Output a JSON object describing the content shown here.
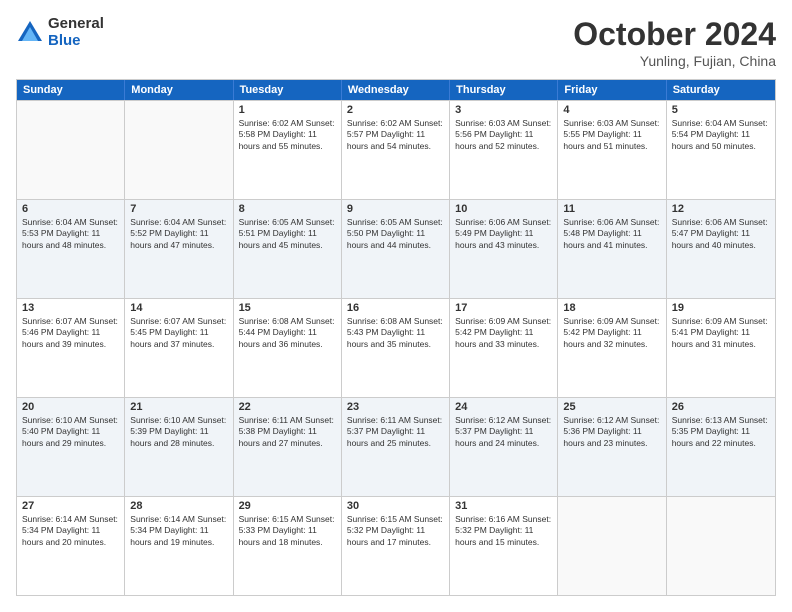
{
  "logo": {
    "general": "General",
    "blue": "Blue"
  },
  "title": "October 2024",
  "subtitle": "Yunling, Fujian, China",
  "header_days": [
    "Sunday",
    "Monday",
    "Tuesday",
    "Wednesday",
    "Thursday",
    "Friday",
    "Saturday"
  ],
  "rows": [
    [
      {
        "day": "",
        "info": ""
      },
      {
        "day": "",
        "info": ""
      },
      {
        "day": "1",
        "info": "Sunrise: 6:02 AM\nSunset: 5:58 PM\nDaylight: 11 hours and 55 minutes."
      },
      {
        "day": "2",
        "info": "Sunrise: 6:02 AM\nSunset: 5:57 PM\nDaylight: 11 hours and 54 minutes."
      },
      {
        "day": "3",
        "info": "Sunrise: 6:03 AM\nSunset: 5:56 PM\nDaylight: 11 hours and 52 minutes."
      },
      {
        "day": "4",
        "info": "Sunrise: 6:03 AM\nSunset: 5:55 PM\nDaylight: 11 hours and 51 minutes."
      },
      {
        "day": "5",
        "info": "Sunrise: 6:04 AM\nSunset: 5:54 PM\nDaylight: 11 hours and 50 minutes."
      }
    ],
    [
      {
        "day": "6",
        "info": "Sunrise: 6:04 AM\nSunset: 5:53 PM\nDaylight: 11 hours and 48 minutes."
      },
      {
        "day": "7",
        "info": "Sunrise: 6:04 AM\nSunset: 5:52 PM\nDaylight: 11 hours and 47 minutes."
      },
      {
        "day": "8",
        "info": "Sunrise: 6:05 AM\nSunset: 5:51 PM\nDaylight: 11 hours and 45 minutes."
      },
      {
        "day": "9",
        "info": "Sunrise: 6:05 AM\nSunset: 5:50 PM\nDaylight: 11 hours and 44 minutes."
      },
      {
        "day": "10",
        "info": "Sunrise: 6:06 AM\nSunset: 5:49 PM\nDaylight: 11 hours and 43 minutes."
      },
      {
        "day": "11",
        "info": "Sunrise: 6:06 AM\nSunset: 5:48 PM\nDaylight: 11 hours and 41 minutes."
      },
      {
        "day": "12",
        "info": "Sunrise: 6:06 AM\nSunset: 5:47 PM\nDaylight: 11 hours and 40 minutes."
      }
    ],
    [
      {
        "day": "13",
        "info": "Sunrise: 6:07 AM\nSunset: 5:46 PM\nDaylight: 11 hours and 39 minutes."
      },
      {
        "day": "14",
        "info": "Sunrise: 6:07 AM\nSunset: 5:45 PM\nDaylight: 11 hours and 37 minutes."
      },
      {
        "day": "15",
        "info": "Sunrise: 6:08 AM\nSunset: 5:44 PM\nDaylight: 11 hours and 36 minutes."
      },
      {
        "day": "16",
        "info": "Sunrise: 6:08 AM\nSunset: 5:43 PM\nDaylight: 11 hours and 35 minutes."
      },
      {
        "day": "17",
        "info": "Sunrise: 6:09 AM\nSunset: 5:42 PM\nDaylight: 11 hours and 33 minutes."
      },
      {
        "day": "18",
        "info": "Sunrise: 6:09 AM\nSunset: 5:42 PM\nDaylight: 11 hours and 32 minutes."
      },
      {
        "day": "19",
        "info": "Sunrise: 6:09 AM\nSunset: 5:41 PM\nDaylight: 11 hours and 31 minutes."
      }
    ],
    [
      {
        "day": "20",
        "info": "Sunrise: 6:10 AM\nSunset: 5:40 PM\nDaylight: 11 hours and 29 minutes."
      },
      {
        "day": "21",
        "info": "Sunrise: 6:10 AM\nSunset: 5:39 PM\nDaylight: 11 hours and 28 minutes."
      },
      {
        "day": "22",
        "info": "Sunrise: 6:11 AM\nSunset: 5:38 PM\nDaylight: 11 hours and 27 minutes."
      },
      {
        "day": "23",
        "info": "Sunrise: 6:11 AM\nSunset: 5:37 PM\nDaylight: 11 hours and 25 minutes."
      },
      {
        "day": "24",
        "info": "Sunrise: 6:12 AM\nSunset: 5:37 PM\nDaylight: 11 hours and 24 minutes."
      },
      {
        "day": "25",
        "info": "Sunrise: 6:12 AM\nSunset: 5:36 PM\nDaylight: 11 hours and 23 minutes."
      },
      {
        "day": "26",
        "info": "Sunrise: 6:13 AM\nSunset: 5:35 PM\nDaylight: 11 hours and 22 minutes."
      }
    ],
    [
      {
        "day": "27",
        "info": "Sunrise: 6:14 AM\nSunset: 5:34 PM\nDaylight: 11 hours and 20 minutes."
      },
      {
        "day": "28",
        "info": "Sunrise: 6:14 AM\nSunset: 5:34 PM\nDaylight: 11 hours and 19 minutes."
      },
      {
        "day": "29",
        "info": "Sunrise: 6:15 AM\nSunset: 5:33 PM\nDaylight: 11 hours and 18 minutes."
      },
      {
        "day": "30",
        "info": "Sunrise: 6:15 AM\nSunset: 5:32 PM\nDaylight: 11 hours and 17 minutes."
      },
      {
        "day": "31",
        "info": "Sunrise: 6:16 AM\nSunset: 5:32 PM\nDaylight: 11 hours and 15 minutes."
      },
      {
        "day": "",
        "info": ""
      },
      {
        "day": "",
        "info": ""
      }
    ]
  ]
}
